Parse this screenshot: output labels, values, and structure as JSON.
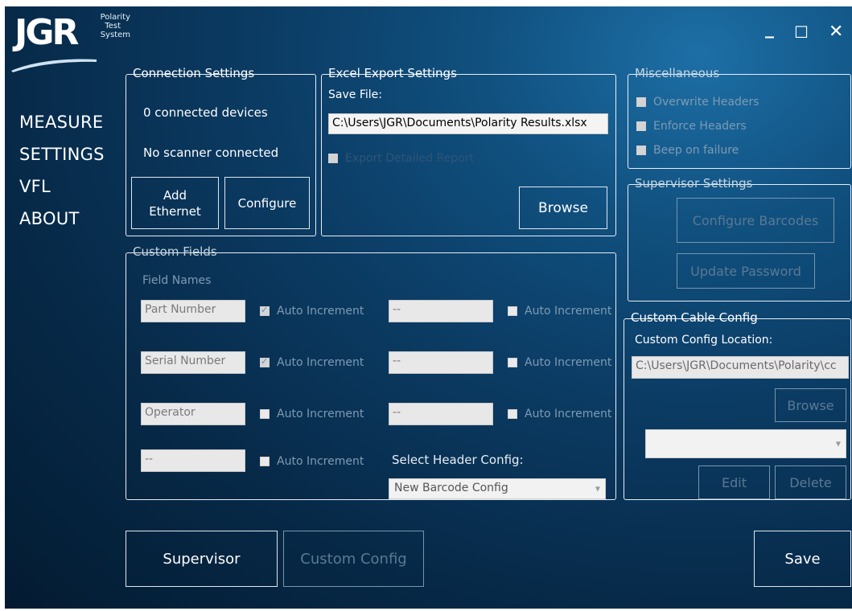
{
  "logo": {
    "text": "JGR",
    "sub": [
      "Polarity",
      "Test",
      "System"
    ]
  },
  "window_controls": {
    "minimize": "_",
    "maximize": "☐",
    "close": "✕"
  },
  "nav": [
    "MEASURE",
    "SETTINGS",
    "VFL",
    "ABOUT"
  ],
  "connection": {
    "title": "Connection Settings",
    "devices": "0 connected devices",
    "scanner": "No scanner connected",
    "add_ethernet": "Add\nEthernet",
    "configure": "Configure"
  },
  "excel": {
    "title": "Excel Export Settings",
    "save_file_label": "Save File:",
    "save_file_value": "C:\\Users\\JGR\\Documents\\Polarity Results.xlsx",
    "export_detailed": "Export Detailed Report",
    "browse": "Browse"
  },
  "misc": {
    "title": "Miscellaneous",
    "items": [
      "Overwrite Headers",
      "Enforce Headers",
      "Beep on failure"
    ]
  },
  "supervisor_settings": {
    "title": "Supervisor Settings",
    "configure_barcodes": "Configure Barcodes",
    "update_password": "Update Password"
  },
  "custom_fields": {
    "title": "Custom Fields",
    "field_names": "Field Names",
    "auto_increment": "Auto Increment",
    "left_fields": [
      "Part Number",
      "Serial Number",
      "Operator",
      "--"
    ],
    "left_checked": [
      true,
      true,
      false,
      false
    ],
    "right_fields": [
      "--",
      "--",
      "--"
    ],
    "select_header_label": "Select Header  Config:",
    "select_header_value": "New Barcode Config"
  },
  "cable_config": {
    "title": "Custom Cable Config",
    "location_label": "Custom Config Location:",
    "location_value": "C:\\Users\\JGR\\Documents\\Polarity\\cc",
    "browse": "Browse",
    "edit": "Edit",
    "delete": "Delete"
  },
  "bottom": {
    "supervisor": "Supervisor",
    "custom_config": "Custom Config",
    "save": "Save"
  },
  "colors": {
    "bg_light": "#1d6fa6",
    "bg_dark": "#031b31",
    "border": "#e9eef3"
  }
}
